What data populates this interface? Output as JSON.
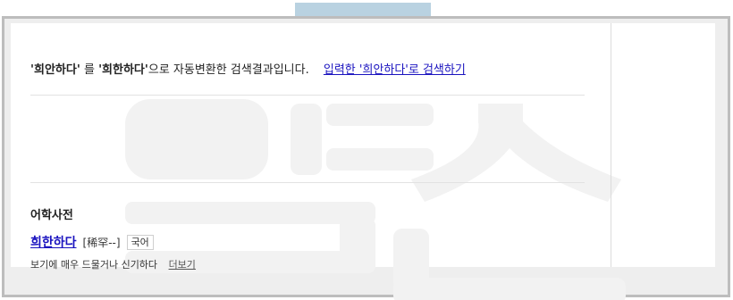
{
  "notice": {
    "original_query_quoted": "'희안하다'",
    "connector": "를",
    "converted_query_quoted": "'희한하다'",
    "suffix": "으로 자동변환한 검색결과입니다.",
    "retry_link": "입력한 '희안하다'로 검색하기"
  },
  "dictionary": {
    "section_title": "어학사전",
    "entry": {
      "headword": "희한하다",
      "hanja": "[稀罕--]",
      "language_badge": "국어",
      "definition": "보기에 매우 드물거나 신기하다",
      "more_link": "더보기"
    }
  },
  "colors": {
    "link": "#1a13bf",
    "tape": "#b9d2e1",
    "frame_border": "#bdbdbd",
    "watermark": "#f2f2f2"
  }
}
